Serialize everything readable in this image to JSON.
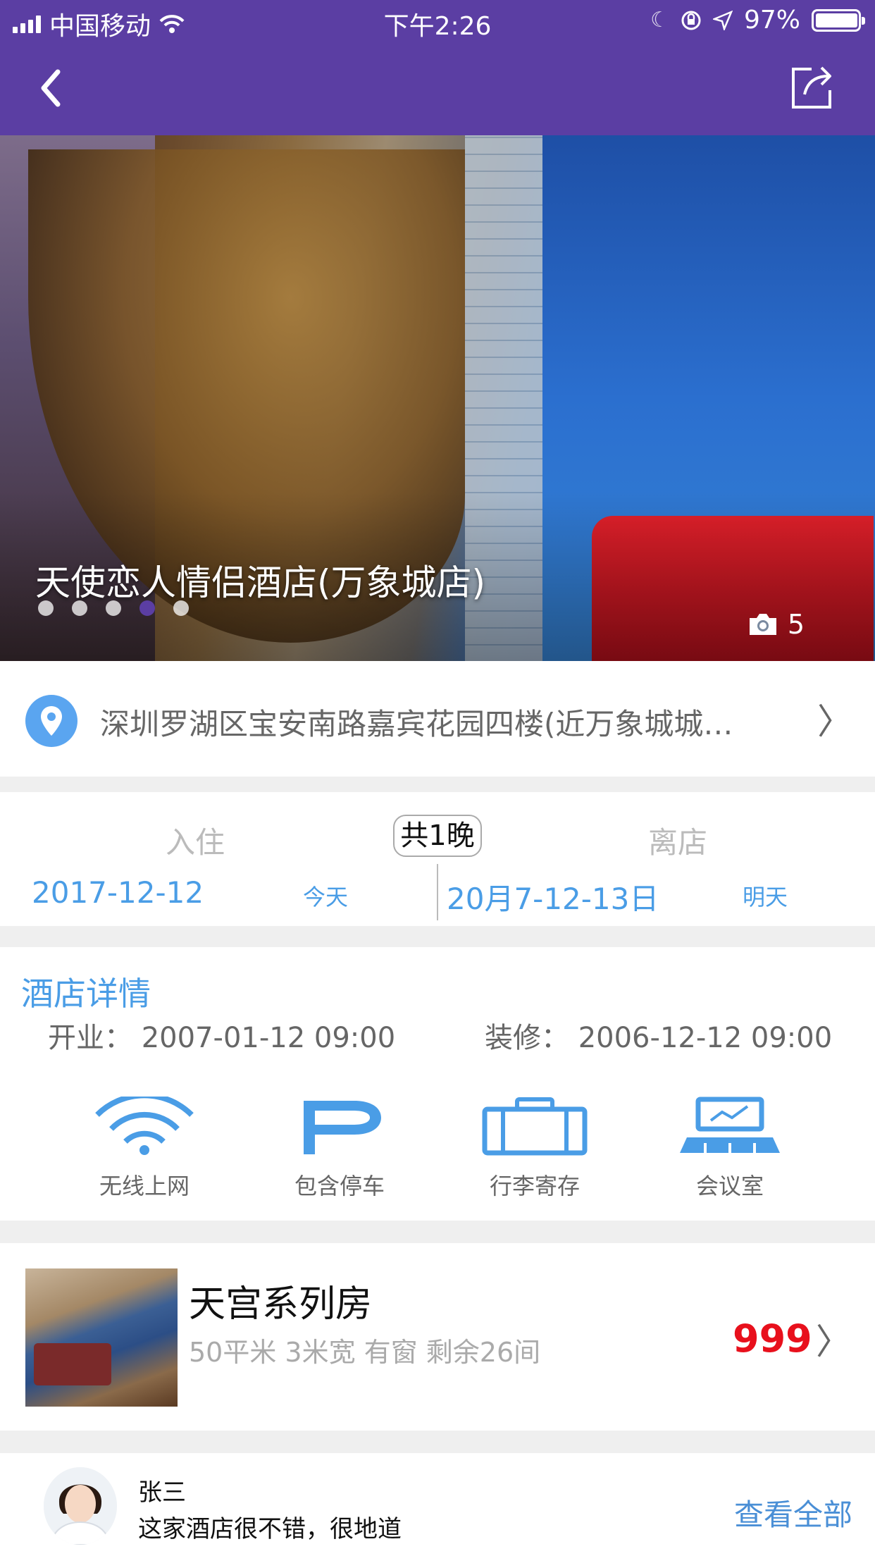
{
  "status_bar": {
    "carrier": "中国移动",
    "time": "下午2:26",
    "battery": "97%",
    "battery_level": 0.97
  },
  "nav": {
    "back_icon": "chevron-left-icon",
    "share_icon": "share-icon"
  },
  "hero": {
    "title": "天使恋人情侣酒店(万象城店)",
    "photo_count": "5",
    "slides_total": 5,
    "slide_active": 4
  },
  "address": {
    "text": "深圳罗湖区宝安南路嘉宾花园四楼(近万象城城…",
    "arrow": "〉"
  },
  "stay": {
    "checkin_label": "入住",
    "checkout_label": "离店",
    "nights": "共1晚",
    "checkin_date": "2017-12-12",
    "checkin_hint": "今天",
    "checkout_date": "20月7-12-13日",
    "checkout_hint": "明天"
  },
  "details": {
    "title": "酒店详情",
    "opened": "开业：  2007-01-12 09:00",
    "renovated": "装修：  2006-12-12 09:00",
    "amenities": [
      {
        "label": "无线上网",
        "icon": "wifi-icon"
      },
      {
        "label": "包含停车",
        "icon": "parking-icon"
      },
      {
        "label": "行李寄存",
        "icon": "luggage-icon"
      },
      {
        "label": "会议室",
        "icon": "meeting-room-icon"
      }
    ]
  },
  "room": {
    "name": "天宫系列房",
    "meta": "50平米 3米宽 有窗 剩余26间",
    "price": "999",
    "arrow": "〉"
  },
  "review": {
    "name": "张三",
    "text": "这家酒店很不错，很地道",
    "view_all": "查看全部"
  },
  "colors": {
    "brand_purple": "#5b3ea3",
    "accent_blue": "#4a9de6",
    "price_red": "#e8101c"
  }
}
